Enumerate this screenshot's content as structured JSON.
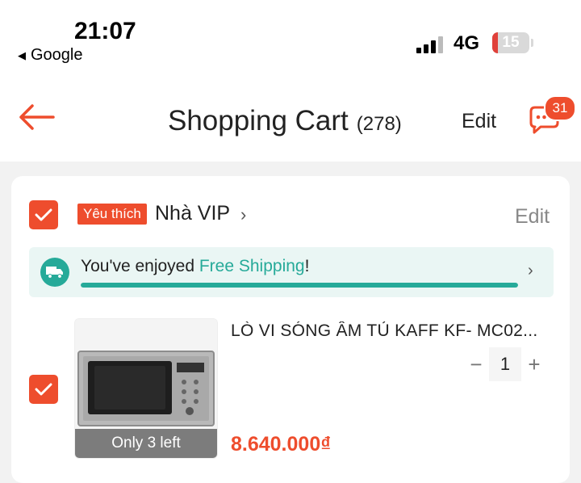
{
  "status_bar": {
    "time": "21:07",
    "back_app": "Google",
    "network": "4G",
    "battery": "15",
    "battery_level": 0.15
  },
  "header": {
    "title": "Shopping Cart",
    "count": "(278)",
    "edit_label": "Edit",
    "chat_badge": "31"
  },
  "shop": {
    "badge": "Yêu thích",
    "name": "Nhà VIP",
    "edit_label": "Edit",
    "checked": true
  },
  "shipping": {
    "text_before": "You've enjoyed ",
    "highlight": "Free Shipping",
    "text_after": "!",
    "progress": 1.0
  },
  "product": {
    "name": "LÒ VI SÓNG ÂM TỦ KAFF KF- MC02...",
    "quantity": "1",
    "minus": "−",
    "plus": "+",
    "price": "8.640.000₫",
    "stock_label": "Only 3 left",
    "checked": true
  },
  "colors": {
    "accent": "#ee4d2d",
    "shipping_green": "#26aa99"
  }
}
